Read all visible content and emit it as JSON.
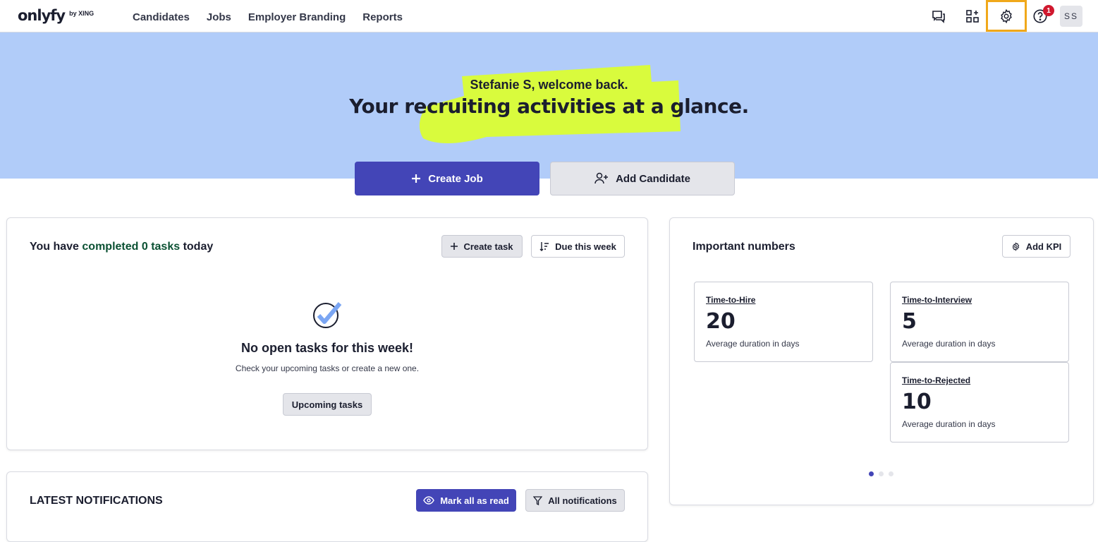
{
  "logo": {
    "name": "onlyfy",
    "suffix": "by XING"
  },
  "nav": {
    "candidates": "Candidates",
    "jobs": "Jobs",
    "employer_branding": "Employer Branding",
    "reports": "Reports"
  },
  "header": {
    "help_badge": "1",
    "avatar_initials": "SS"
  },
  "hero": {
    "welcome": "Stefanie S, welcome back.",
    "headline": "Your recruiting activities at a glance.",
    "highlight_color": "#d9fb3d",
    "background_color": "#b1ccf9"
  },
  "actions": {
    "create_job": "Create Job",
    "add_candidate": "Add Candidate"
  },
  "tasks": {
    "title_prefix": "You have ",
    "title_highlight": "completed 0 tasks",
    "title_suffix": " today",
    "create_task": "Create task",
    "due_filter": "Due this week",
    "empty_title": "No open tasks for this week!",
    "empty_sub": "Check your upcoming tasks or create a new one.",
    "upcoming_button": "Upcoming tasks"
  },
  "numbers": {
    "title": "Important numbers",
    "add_kpi": "Add KPI",
    "kpis": [
      {
        "label": "Time-to-Hire",
        "value": "20",
        "sub": "Average duration in days"
      },
      {
        "label": "Time-to-Interview",
        "value": "5",
        "sub": "Average duration in days"
      },
      {
        "label": "Time-to-Rejected",
        "value": "10",
        "sub": "Average duration in days"
      }
    ],
    "carousel_pages": 3,
    "carousel_active": 1
  },
  "notifications": {
    "title": "LATEST NOTIFICATIONS",
    "mark_all_read": "Mark all as read",
    "all_notifications": "All notifications"
  },
  "colors": {
    "primary": "#4345b7",
    "accent_highlight": "#f0a81a",
    "badge": "#d0182e",
    "success_text": "#0b5133"
  }
}
